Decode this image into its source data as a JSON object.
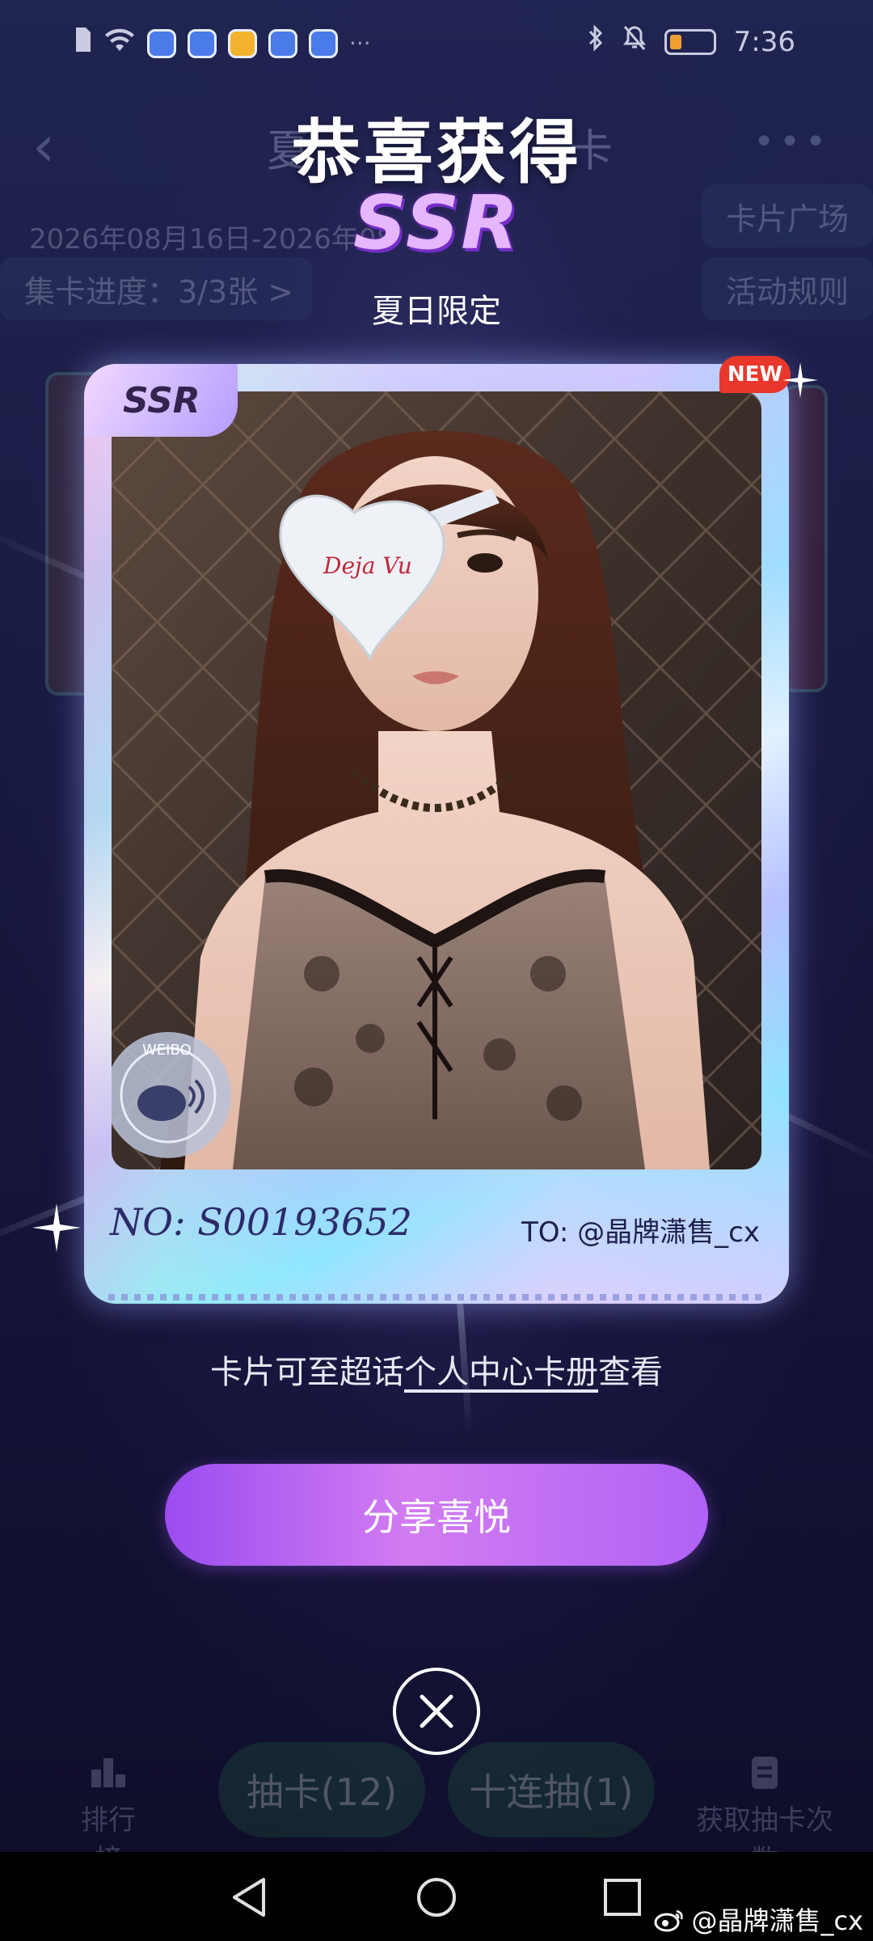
{
  "status_bar": {
    "time": "7:36",
    "app_icons": [
      "browser-icon",
      "browser-icon",
      "weibo-icon",
      "browser-icon",
      "browser-icon"
    ],
    "overflow": "···"
  },
  "background_page": {
    "title": "夏",
    "title_tail": "卡",
    "date_range": "2026年08月16日-2026年08",
    "card_square_button": "卡片广场",
    "progress_label": "集卡进度：3/3张 >",
    "rules_button": "活动规则",
    "bottom_nav": {
      "ranking_label": "排行榜",
      "draw_button": "抽卡(12)",
      "ten_draw_button": "十连抽(1)",
      "get_draws_label": "获取抽卡次数"
    }
  },
  "reward": {
    "headline": "恭喜获得",
    "rarity": "SSR",
    "subtitle": "夏日限定"
  },
  "card": {
    "rarity_tag": "SSR",
    "new_badge": "NEW",
    "number_prefix": "NO:",
    "number": "S00193652",
    "owner": "TO: @晶牌潇售_cx",
    "stamp_text": "WEIBO",
    "eyepatch_text": "Deja Vu"
  },
  "hint": {
    "prefix": "卡片可至超话",
    "link": "个人中心卡册",
    "suffix": "查看"
  },
  "share_button": "分享喜悦",
  "watermark": "@晶牌潇售_cx",
  "colors": {
    "accent_purple": "#b062f5",
    "new_badge": "#e9372c",
    "card_text": "#2c2a6a"
  }
}
